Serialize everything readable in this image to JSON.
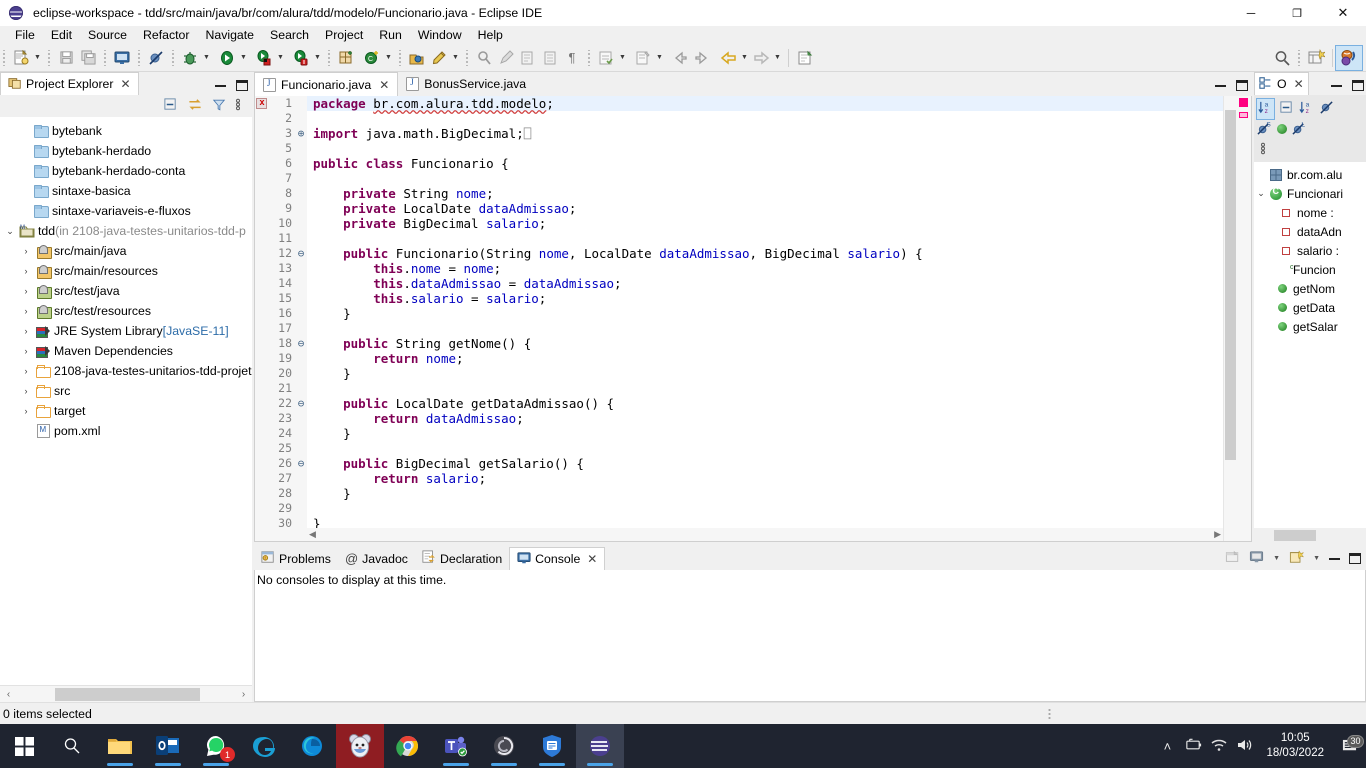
{
  "window": {
    "title": "eclipse-workspace - tdd/src/main/java/br/com/alura/tdd/modelo/Funcionario.java - Eclipse IDE",
    "app_icon": "eclipse-icon",
    "minimize": "–",
    "maximize": "❐",
    "close": "✕"
  },
  "menubar": {
    "items": [
      "File",
      "Edit",
      "Source",
      "Refactor",
      "Navigate",
      "Search",
      "Project",
      "Run",
      "Window",
      "Help"
    ]
  },
  "toolbar": {
    "icons": [
      "new-wizard-icon",
      "save-icon",
      "save-all-icon",
      "open-console-icon",
      "skip-breakpoints-icon",
      "debug-icon",
      "run-icon",
      "run-external-tools-icon",
      "run-coverage-icon",
      "new-java-package-icon",
      "new-java-class-icon",
      "open-type-icon",
      "search-refactor-icon",
      "toggle-mark-occurrences-icon",
      "last-edit-location-icon",
      "next-annotation-icon",
      "previous-annotation-icon",
      "show-whitespace-icon",
      "back-icon",
      "forward-icon",
      "pin-editor-icon"
    ],
    "search_icon": "search-icon",
    "perspective_new_icon": "open-perspective-icon",
    "perspective_java_icon": "java-perspective-icon"
  },
  "project_explorer": {
    "tab_label": "Project Explorer",
    "tab_icon": "project-explorer-icon",
    "close_icon": "close-icon",
    "toolbar_icons": [
      "collapse-all-icon",
      "link-with-editor-icon",
      "view-filter-icon",
      "view-menu-icon"
    ],
    "minimize_icon": "minimize-icon",
    "maximize_icon": "maximize-icon",
    "tree": [
      {
        "label": "bytebank",
        "icon": "closed-project-icon",
        "twisty": "",
        "indent": 16
      },
      {
        "label": "bytebank-herdado",
        "icon": "closed-project-icon",
        "twisty": "",
        "indent": 16
      },
      {
        "label": "bytebank-herdado-conta",
        "icon": "closed-project-icon",
        "twisty": "",
        "indent": 16
      },
      {
        "label": "sintaxe-basica",
        "icon": "closed-project-icon",
        "twisty": "",
        "indent": 16
      },
      {
        "label": "sintaxe-variaveis-e-fluxos",
        "icon": "closed-project-icon",
        "twisty": "",
        "indent": 16
      },
      {
        "label": "tdd",
        "suffix": " (in 2108-java-testes-unitarios-tdd-p",
        "icon": "maven-project-icon",
        "twisty": "⌄",
        "indent": 2
      },
      {
        "label": "src/main/java",
        "icon": "source-folder-icon",
        "twisty": "›",
        "indent": 18
      },
      {
        "label": "src/main/resources",
        "icon": "source-folder-icon",
        "twisty": "›",
        "indent": 18
      },
      {
        "label": "src/test/java",
        "icon": "test-source-folder-icon",
        "twisty": "›",
        "indent": 18
      },
      {
        "label": "src/test/resources",
        "icon": "test-source-folder-icon",
        "twisty": "›",
        "indent": 18
      },
      {
        "label": "JRE System Library",
        "suffix": " [JavaSE-11]",
        "icon": "library-icon",
        "twisty": "›",
        "indent": 18
      },
      {
        "label": "Maven Dependencies",
        "icon": "library-icon",
        "twisty": "›",
        "indent": 18
      },
      {
        "label": "2108-java-testes-unitarios-tdd-projet",
        "icon": "folder-icon",
        "twisty": "›",
        "indent": 18
      },
      {
        "label": "src",
        "icon": "folder-icon",
        "twisty": "›",
        "indent": 18
      },
      {
        "label": "target",
        "icon": "folder-icon",
        "twisty": "›",
        "indent": 18
      },
      {
        "label": "pom.xml",
        "icon": "xml-file-icon",
        "twisty": "",
        "indent": 18
      }
    ],
    "hscroll_left_icon": "‹",
    "hscroll_right_icon": "›"
  },
  "editor": {
    "tabs": [
      {
        "label": "Funcionario.java",
        "icon": "java-file-icon",
        "active": true,
        "close_icon": "✕"
      },
      {
        "label": "BonusService.java",
        "icon": "java-file-icon",
        "active": false
      }
    ],
    "minimize_icon": "minimize-icon",
    "maximize_icon": "maximize-icon",
    "error_marker": "error-marker-icon",
    "lines": [
      {
        "no": "1",
        "fold": "",
        "current": true,
        "parts": [
          {
            "t": "package ",
            "c": "kw"
          },
          {
            "t": "br.com.alura.tdd.modelo",
            "c": "pkgpath"
          },
          {
            "t": ";",
            "c": ""
          }
        ]
      },
      {
        "no": "2",
        "fold": "",
        "parts": []
      },
      {
        "no": "3",
        "fold": "⊕",
        "parts": [
          {
            "t": "import ",
            "c": "kw"
          },
          {
            "t": "java.math.BigDecimal;",
            "c": ""
          },
          {
            "t": "⎕",
            "c": "dim"
          }
        ]
      },
      {
        "no": "5",
        "fold": "",
        "parts": []
      },
      {
        "no": "6",
        "fold": "",
        "parts": [
          {
            "t": "public class ",
            "c": "kw"
          },
          {
            "t": "Funcionario {",
            "c": ""
          }
        ]
      },
      {
        "no": "7",
        "fold": "",
        "parts": []
      },
      {
        "no": "8",
        "fold": "",
        "parts": [
          {
            "t": "    private ",
            "c": "kw"
          },
          {
            "t": "String ",
            "c": ""
          },
          {
            "t": "nome",
            "c": "fld"
          },
          {
            "t": ";",
            "c": ""
          }
        ]
      },
      {
        "no": "9",
        "fold": "",
        "parts": [
          {
            "t": "    private ",
            "c": "kw"
          },
          {
            "t": "LocalDate ",
            "c": ""
          },
          {
            "t": "dataAdmissao",
            "c": "fld"
          },
          {
            "t": ";",
            "c": ""
          }
        ]
      },
      {
        "no": "10",
        "fold": "",
        "parts": [
          {
            "t": "    private ",
            "c": "kw"
          },
          {
            "t": "BigDecimal ",
            "c": ""
          },
          {
            "t": "salario",
            "c": "fld"
          },
          {
            "t": ";",
            "c": ""
          }
        ]
      },
      {
        "no": "11",
        "fold": "",
        "parts": []
      },
      {
        "no": "12",
        "fold": "⊖",
        "parts": [
          {
            "t": "    public ",
            "c": "kw"
          },
          {
            "t": "Funcionario(String ",
            "c": ""
          },
          {
            "t": "nome",
            "c": "fld"
          },
          {
            "t": ", LocalDate ",
            "c": ""
          },
          {
            "t": "dataAdmissao",
            "c": "fld"
          },
          {
            "t": ", BigDecimal ",
            "c": ""
          },
          {
            "t": "salario",
            "c": "fld"
          },
          {
            "t": ") {",
            "c": ""
          }
        ]
      },
      {
        "no": "13",
        "fold": "",
        "parts": [
          {
            "t": "        this",
            "c": "kw"
          },
          {
            "t": ".",
            "c": ""
          },
          {
            "t": "nome",
            "c": "fld"
          },
          {
            "t": " = ",
            "c": ""
          },
          {
            "t": "nome",
            "c": "fld"
          },
          {
            "t": ";",
            "c": ""
          }
        ]
      },
      {
        "no": "14",
        "fold": "",
        "parts": [
          {
            "t": "        this",
            "c": "kw"
          },
          {
            "t": ".",
            "c": ""
          },
          {
            "t": "dataAdmissao",
            "c": "fld"
          },
          {
            "t": " = ",
            "c": ""
          },
          {
            "t": "dataAdmissao",
            "c": "fld"
          },
          {
            "t": ";",
            "c": ""
          }
        ]
      },
      {
        "no": "15",
        "fold": "",
        "parts": [
          {
            "t": "        this",
            "c": "kw"
          },
          {
            "t": ".",
            "c": ""
          },
          {
            "t": "salario",
            "c": "fld"
          },
          {
            "t": " = ",
            "c": ""
          },
          {
            "t": "salario",
            "c": "fld"
          },
          {
            "t": ";",
            "c": ""
          }
        ]
      },
      {
        "no": "16",
        "fold": "",
        "parts": [
          {
            "t": "    }",
            "c": ""
          }
        ]
      },
      {
        "no": "17",
        "fold": "",
        "parts": []
      },
      {
        "no": "18",
        "fold": "⊖",
        "parts": [
          {
            "t": "    public ",
            "c": "kw"
          },
          {
            "t": "String getNome() {",
            "c": ""
          }
        ]
      },
      {
        "no": "19",
        "fold": "",
        "parts": [
          {
            "t": "        return ",
            "c": "kw"
          },
          {
            "t": "nome",
            "c": "fld"
          },
          {
            "t": ";",
            "c": ""
          }
        ]
      },
      {
        "no": "20",
        "fold": "",
        "parts": [
          {
            "t": "    }",
            "c": ""
          }
        ]
      },
      {
        "no": "21",
        "fold": "",
        "parts": []
      },
      {
        "no": "22",
        "fold": "⊖",
        "parts": [
          {
            "t": "    public ",
            "c": "kw"
          },
          {
            "t": "LocalDate getDataAdmissao() {",
            "c": ""
          }
        ]
      },
      {
        "no": "23",
        "fold": "",
        "parts": [
          {
            "t": "        return ",
            "c": "kw"
          },
          {
            "t": "dataAdmissao",
            "c": "fld"
          },
          {
            "t": ";",
            "c": ""
          }
        ]
      },
      {
        "no": "24",
        "fold": "",
        "parts": [
          {
            "t": "    }",
            "c": ""
          }
        ]
      },
      {
        "no": "25",
        "fold": "",
        "parts": []
      },
      {
        "no": "26",
        "fold": "⊖",
        "parts": [
          {
            "t": "    public ",
            "c": "kw"
          },
          {
            "t": "BigDecimal getSalario() {",
            "c": ""
          }
        ]
      },
      {
        "no": "27",
        "fold": "",
        "parts": [
          {
            "t": "        return ",
            "c": "kw"
          },
          {
            "t": "salario",
            "c": "fld"
          },
          {
            "t": ";",
            "c": ""
          }
        ]
      },
      {
        "no": "28",
        "fold": "",
        "parts": [
          {
            "t": "    }",
            "c": ""
          }
        ]
      },
      {
        "no": "29",
        "fold": "",
        "parts": []
      },
      {
        "no": "30",
        "fold": "",
        "parts": [
          {
            "t": "}",
            "c": ""
          }
        ]
      }
    ]
  },
  "outline": {
    "tab_icon": "outline-icon",
    "tab_label": "O",
    "close_icon": "✕",
    "minimize_icon": "minimize-icon",
    "maximize_icon": "maximize-icon",
    "toolbar_icons": [
      "sort-icon",
      "collapse-all-icon",
      "sort-alpha-icon",
      "hide-fields-icon",
      "hide-static-icon",
      "hide-nonpublic-icon",
      "hide-local-types-icon",
      "view-menu-icon"
    ],
    "items": [
      {
        "label": "br.com.alu",
        "icon": "package-icon",
        "twisty": "",
        "indent": 14
      },
      {
        "label": "Funcionari",
        "icon": "class-icon",
        "twisty": "⌄",
        "indent": 0
      },
      {
        "label": "nome : ",
        "icon": "private-field-icon",
        "twisty": "",
        "indent": 24
      },
      {
        "label": "dataAdn",
        "icon": "private-field-icon",
        "twisty": "",
        "indent": 24
      },
      {
        "label": "salario :",
        "icon": "private-field-icon",
        "twisty": "",
        "indent": 24
      },
      {
        "label": "Funcion",
        "icon": "constructor-icon",
        "twisty": "",
        "indent": 20
      },
      {
        "label": "getNom",
        "icon": "public-method-icon",
        "twisty": "",
        "indent": 20
      },
      {
        "label": "getData",
        "icon": "public-method-icon",
        "twisty": "",
        "indent": 20
      },
      {
        "label": "getSalar",
        "icon": "public-method-icon",
        "twisty": "",
        "indent": 20
      }
    ]
  },
  "bottom_panel": {
    "tabs": [
      {
        "label": "Problems",
        "icon": "problems-icon",
        "active": false
      },
      {
        "label": "Javadoc",
        "icon": "javadoc-icon",
        "active": false
      },
      {
        "label": "Declaration",
        "icon": "declaration-icon",
        "active": false
      },
      {
        "label": "Console",
        "icon": "console-icon",
        "active": true,
        "close_icon": "✕"
      }
    ],
    "content": "No consoles to display at this time.",
    "toolbar_icons": [
      "open-console-view-icon",
      "display-selected-console-icon",
      "open-console-icon"
    ],
    "minimize_icon": "minimize-icon",
    "maximize_icon": "maximize-icon"
  },
  "statusbar": {
    "text": "0 items selected"
  },
  "taskbar": {
    "items": [
      {
        "name": "start-button",
        "icon": "windows-logo-icon"
      },
      {
        "name": "search-button",
        "icon": "search-icon"
      },
      {
        "name": "file-explorer",
        "icon": "file-explorer-icon",
        "running": true
      },
      {
        "name": "outlook",
        "icon": "outlook-icon",
        "running": true
      },
      {
        "name": "whatsapp",
        "icon": "whatsapp-icon",
        "badge": "1",
        "running": true
      },
      {
        "name": "internet-explorer",
        "icon": "internet-explorer-icon"
      },
      {
        "name": "microsoft-edge",
        "icon": "edge-icon"
      },
      {
        "name": "mouse-app",
        "icon": "mouse-icon",
        "highlight": "red"
      },
      {
        "name": "google-chrome",
        "icon": "chrome-icon"
      },
      {
        "name": "microsoft-teams",
        "icon": "teams-icon",
        "running": true
      },
      {
        "name": "spiral-app",
        "icon": "spiral-icon",
        "running": true
      },
      {
        "name": "security-app",
        "icon": "shield-icon",
        "running": true
      },
      {
        "name": "eclipse-ide",
        "icon": "eclipse-icon",
        "active": true,
        "running": true
      }
    ],
    "tray": {
      "chevron": "˄",
      "icons": [
        "battery-icon",
        "wifi-icon",
        "volume-icon"
      ],
      "time": "10:05",
      "date": "18/03/2022",
      "notification_count": "30",
      "notification_icon": "notification-icon"
    }
  }
}
